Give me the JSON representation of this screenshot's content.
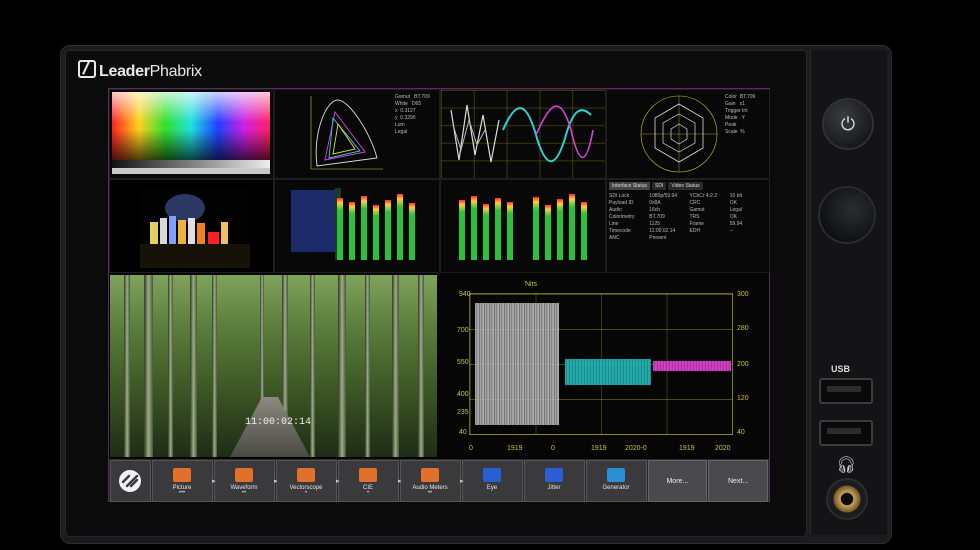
{
  "brand": {
    "name_bold": "Leader",
    "name_light": "Phabrix"
  },
  "panes": {
    "colorbars_label": "",
    "cie_label": "",
    "cie_info": "Gamut   BT.709\nWhite   D65\nx  0.3127\ny  0.3290\nLum     \nLegal",
    "waveform_small_label": "",
    "vector_label": "",
    "vector_info": "Color  BT.709\nGain   x1\nTrigger Int\nMode   Y\nPeak   \nScale  %",
    "status_tabs": [
      "Interface Status",
      "SDI",
      "Video Status"
    ],
    "status_rows": [
      "SDI Lock",
      "1080p/59.94",
      "YCbCr 4:2:2",
      "10 bit",
      "Payload ID",
      "0x8A",
      "CRC",
      "OK",
      "Audio",
      "16ch",
      "Gamut",
      "Legal",
      "Colorimetry",
      "BT.709",
      "TRS",
      "OK",
      "Line",
      "1125",
      "Frame",
      "59.94",
      "Timecode",
      "11:00:02:14",
      "EDH",
      "--",
      "ANC",
      "Present"
    ],
    "picture_timecode": "11:00:02:14",
    "wave_left_axis": [
      "940",
      "700",
      "550",
      "400",
      "235",
      "40"
    ],
    "wave_right_axis": [
      "300",
      "280",
      "200",
      "120",
      "40"
    ],
    "wave_top_label": "Nits",
    "wave_bottom_axis": [
      "0",
      "1919",
      "0",
      "1919",
      "2020-0",
      "1919",
      "2020"
    ]
  },
  "toolbar": {
    "items": [
      {
        "label": "Picture",
        "icon": "picture-icon",
        "color": "#e0702a",
        "dots": "•••"
      },
      {
        "label": "Waveform",
        "icon": "waveform-icon",
        "color": "#e0702a",
        "dots": "••"
      },
      {
        "label": "Vectorscope",
        "icon": "vectorscope-icon",
        "color": "#e0702a",
        "dots": "•"
      },
      {
        "label": "CIE",
        "icon": "cie-icon",
        "color": "#e0702a",
        "dots": "•"
      },
      {
        "label": "Audio Meters",
        "icon": "audio-meters-icon",
        "color": "#e0702a",
        "dots": "••"
      },
      {
        "label": "Eye",
        "icon": "eye-icon",
        "color": "#2a5fd4",
        "dots": ""
      },
      {
        "label": "Jitter",
        "icon": "jitter-icon",
        "color": "#2a5fd4",
        "dots": ""
      },
      {
        "label": "Generator",
        "icon": "generator-icon",
        "color": "#2a8fd4",
        "dots": ""
      }
    ],
    "more_label": "More...",
    "next_label": "Next..."
  },
  "side": {
    "usb_label": "USB"
  }
}
